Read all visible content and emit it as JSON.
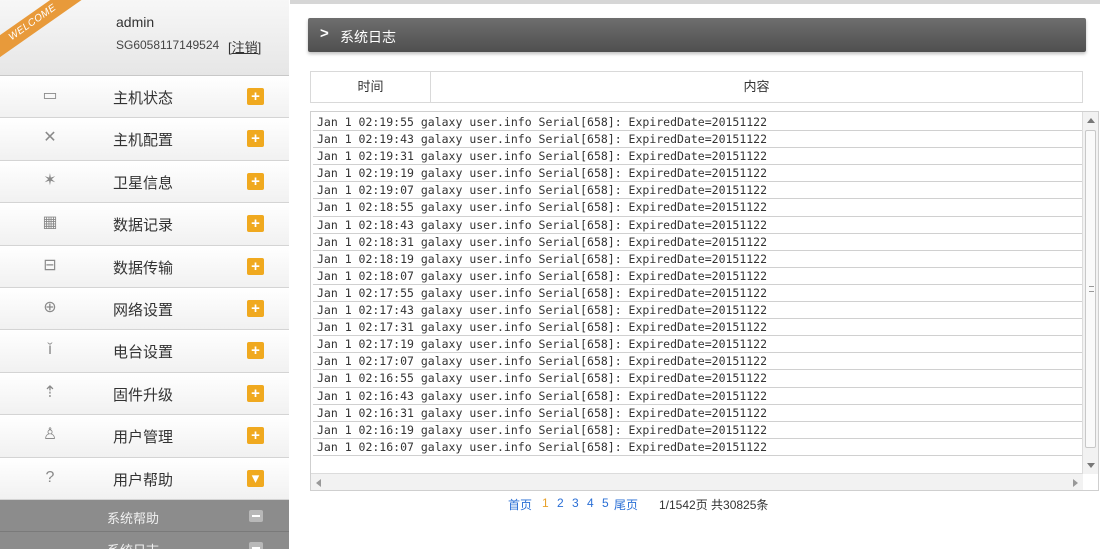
{
  "user": {
    "welcome": "WELCOME",
    "name": "admin",
    "serial": "SG6058117149524",
    "logout": "[注销]"
  },
  "menu": [
    {
      "label": "主机状态",
      "icon": "monitor-icon",
      "glyph": "▭",
      "toggle": "+"
    },
    {
      "label": "主机配置",
      "icon": "tools-icon",
      "glyph": "✕",
      "toggle": "+"
    },
    {
      "label": "卫星信息",
      "icon": "satellite-icon",
      "glyph": "✶",
      "toggle": "+"
    },
    {
      "label": "数据记录",
      "icon": "calendar-icon",
      "glyph": "▦",
      "toggle": "+"
    },
    {
      "label": "数据传输",
      "icon": "network-icon",
      "glyph": "⊟",
      "toggle": "+"
    },
    {
      "label": "网络设置",
      "icon": "globe-icon",
      "glyph": "⊕",
      "toggle": "+"
    },
    {
      "label": "电台设置",
      "icon": "radio-icon",
      "glyph": "ǐ",
      "toggle": "+"
    },
    {
      "label": "固件升级",
      "icon": "upload-icon",
      "glyph": "⇡",
      "toggle": "+"
    },
    {
      "label": "用户管理",
      "icon": "users-icon",
      "glyph": "♙",
      "toggle": "+"
    },
    {
      "label": "用户帮助",
      "icon": "help-icon",
      "glyph": "?",
      "toggle": "▾"
    }
  ],
  "submenu": [
    {
      "label": "系统帮助"
    },
    {
      "label": "系统日志"
    }
  ],
  "main": {
    "title": "系统日志",
    "col_time": "时间",
    "col_content": "内容"
  },
  "logs": [
    "Jan 1 02:19:55 galaxy user.info Serial[658]: ExpiredDate=20151122",
    "Jan 1 02:19:43 galaxy user.info Serial[658]: ExpiredDate=20151122",
    "Jan 1 02:19:31 galaxy user.info Serial[658]: ExpiredDate=20151122",
    "Jan 1 02:19:19 galaxy user.info Serial[658]: ExpiredDate=20151122",
    "Jan 1 02:19:07 galaxy user.info Serial[658]: ExpiredDate=20151122",
    "Jan 1 02:18:55 galaxy user.info Serial[658]: ExpiredDate=20151122",
    "Jan 1 02:18:43 galaxy user.info Serial[658]: ExpiredDate=20151122",
    "Jan 1 02:18:31 galaxy user.info Serial[658]: ExpiredDate=20151122",
    "Jan 1 02:18:19 galaxy user.info Serial[658]: ExpiredDate=20151122",
    "Jan 1 02:18:07 galaxy user.info Serial[658]: ExpiredDate=20151122",
    "Jan 1 02:17:55 galaxy user.info Serial[658]: ExpiredDate=20151122",
    "Jan 1 02:17:43 galaxy user.info Serial[658]: ExpiredDate=20151122",
    "Jan 1 02:17:31 galaxy user.info Serial[658]: ExpiredDate=20151122",
    "Jan 1 02:17:19 galaxy user.info Serial[658]: ExpiredDate=20151122",
    "Jan 1 02:17:07 galaxy user.info Serial[658]: ExpiredDate=20151122",
    "Jan 1 02:16:55 galaxy user.info Serial[658]: ExpiredDate=20151122",
    "Jan 1 02:16:43 galaxy user.info Serial[658]: ExpiredDate=20151122",
    "Jan 1 02:16:31 galaxy user.info Serial[658]: ExpiredDate=20151122",
    "Jan 1 02:16:19 galaxy user.info Serial[658]: ExpiredDate=20151122",
    "Jan 1 02:16:07 galaxy user.info Serial[658]: ExpiredDate=20151122"
  ],
  "pager": {
    "first": "首页",
    "pages": [
      "1",
      "2",
      "3",
      "4",
      "5"
    ],
    "current": "1",
    "last": "尾页",
    "info": "1/1542页 共30825条"
  }
}
